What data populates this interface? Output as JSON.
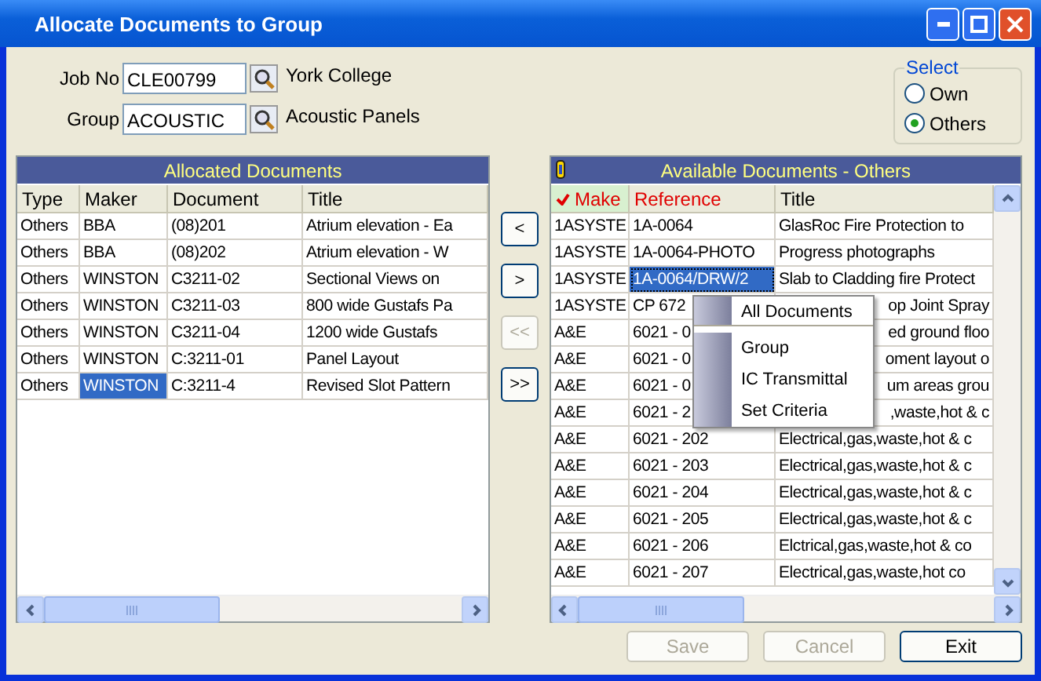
{
  "window": {
    "title": "Allocate Documents to Group"
  },
  "fields": [
    {
      "label": "Job No",
      "value": "CLE00799",
      "description": "York College"
    },
    {
      "label": "Group",
      "value": "ACOUSTIC",
      "description": "Acoustic Panels"
    }
  ],
  "select": {
    "title": "Select",
    "options": [
      {
        "label": "Own",
        "selected": false
      },
      {
        "label": "Others",
        "selected": true
      }
    ]
  },
  "allocated": {
    "title": "Allocated Documents",
    "columns": [
      "Type",
      "Maker",
      "Document",
      "Title"
    ],
    "rows": [
      {
        "cells": [
          {
            "text": "Others",
            "selected": false
          },
          {
            "text": "BBA",
            "selected": false
          },
          {
            "text": "(08)201",
            "selected": false
          },
          {
            "text": "Atrium elevation - Ea",
            "selected": false
          }
        ]
      },
      {
        "cells": [
          {
            "text": "Others",
            "selected": false
          },
          {
            "text": "BBA",
            "selected": false
          },
          {
            "text": "(08)202",
            "selected": false
          },
          {
            "text": "Atrium elevation - W",
            "selected": false
          }
        ]
      },
      {
        "cells": [
          {
            "text": "Others",
            "selected": false
          },
          {
            "text": "WINSTON",
            "selected": false
          },
          {
            "text": "C3211-02",
            "selected": false
          },
          {
            "text": "Sectional Views on",
            "selected": false
          }
        ]
      },
      {
        "cells": [
          {
            "text": "Others",
            "selected": false
          },
          {
            "text": "WINSTON",
            "selected": false
          },
          {
            "text": "C3211-03",
            "selected": false
          },
          {
            "text": "800 wide Gustafs Pa",
            "selected": false
          }
        ]
      },
      {
        "cells": [
          {
            "text": "Others",
            "selected": false
          },
          {
            "text": "WINSTON",
            "selected": false
          },
          {
            "text": "C3211-04",
            "selected": false
          },
          {
            "text": "1200 wide Gustafs",
            "selected": false
          }
        ]
      },
      {
        "cells": [
          {
            "text": "Others",
            "selected": false
          },
          {
            "text": "WINSTON",
            "selected": false
          },
          {
            "text": "C:3211-01",
            "selected": false
          },
          {
            "text": "Panel Layout",
            "selected": false
          }
        ]
      },
      {
        "cells": [
          {
            "text": "Others",
            "selected": false
          },
          {
            "text": "WINSTON",
            "selected": true
          },
          {
            "text": "C:3211-4",
            "selected": false
          },
          {
            "text": "Revised Slot Pattern",
            "selected": false
          }
        ]
      }
    ]
  },
  "move_buttons": [
    {
      "label": "<",
      "disabled": false
    },
    {
      "label": ">",
      "disabled": false
    },
    {
      "label": "<<",
      "disabled": true
    },
    {
      "label": ">>",
      "disabled": false
    }
  ],
  "available": {
    "title": "Available Documents - Others",
    "columns": [
      {
        "label": "Make",
        "checked": true,
        "highlighted": true
      },
      {
        "label": "Reference",
        "checked": false,
        "highlighted": true
      },
      {
        "label": "Title",
        "checked": false,
        "highlighted": false
      }
    ],
    "rows": [
      {
        "kind": "plain",
        "cells": [
          {
            "text": "1ASYSTE",
            "selected": false
          },
          {
            "text": "1A-0064",
            "selected": false
          },
          {
            "text": "GlasRoc Fire Protection to",
            "selected": false
          }
        ]
      },
      {
        "kind": "plain",
        "cells": [
          {
            "text": "1ASYSTE",
            "selected": false
          },
          {
            "text": "1A-0064-PHOTO",
            "selected": false
          },
          {
            "text": "Progress photographs",
            "selected": false
          }
        ]
      },
      {
        "kind": "plain",
        "cells": [
          {
            "text": "1ASYSTE",
            "selected": false
          },
          {
            "text": "1A-0064/DRW/2",
            "selected": true
          },
          {
            "text": "Slab to Cladding fire Protect",
            "selected": false
          }
        ]
      },
      {
        "kind": "covered",
        "cells": [
          {
            "text": "1ASYSTE",
            "selected": false
          },
          {
            "text": "CP 672",
            "selected": false
          },
          {
            "text": "op Joint Spray",
            "selected": false
          }
        ]
      },
      {
        "kind": "covered",
        "cells": [
          {
            "text": "A&E",
            "selected": false
          },
          {
            "text": "6021 - 0",
            "selected": false
          },
          {
            "text": "ed ground floo",
            "selected": false
          }
        ]
      },
      {
        "kind": "covered",
        "cells": [
          {
            "text": "A&E",
            "selected": false
          },
          {
            "text": "6021 - 0",
            "selected": false
          },
          {
            "text": "oment layout o",
            "selected": false
          }
        ]
      },
      {
        "kind": "covered",
        "cells": [
          {
            "text": "A&E",
            "selected": false
          },
          {
            "text": "6021 - 0",
            "selected": false
          },
          {
            "text": "um areas grou",
            "selected": false
          }
        ]
      },
      {
        "kind": "covered",
        "cells": [
          {
            "text": "A&E",
            "selected": false
          },
          {
            "text": "6021 - 2",
            "selected": false
          },
          {
            "text": ",waste,hot & c",
            "selected": false
          }
        ]
      },
      {
        "kind": "plain",
        "cells": [
          {
            "text": "A&E",
            "selected": false
          },
          {
            "text": "6021 - 202",
            "selected": false
          },
          {
            "text": "Electrical,gas,waste,hot & c",
            "selected": false
          }
        ]
      },
      {
        "kind": "plain",
        "cells": [
          {
            "text": "A&E",
            "selected": false
          },
          {
            "text": "6021 - 203",
            "selected": false
          },
          {
            "text": "Electrical,gas,waste,hot & c",
            "selected": false
          }
        ]
      },
      {
        "kind": "plain",
        "cells": [
          {
            "text": "A&E",
            "selected": false
          },
          {
            "text": "6021 - 204",
            "selected": false
          },
          {
            "text": "Electrical,gas,waste,hot & c",
            "selected": false
          }
        ]
      },
      {
        "kind": "plain",
        "cells": [
          {
            "text": "A&E",
            "selected": false
          },
          {
            "text": "6021 - 205",
            "selected": false
          },
          {
            "text": "Electrical,gas,waste,hot & c",
            "selected": false
          }
        ]
      },
      {
        "kind": "plain",
        "cells": [
          {
            "text": "A&E",
            "selected": false
          },
          {
            "text": "6021 - 206",
            "selected": false
          },
          {
            "text": "Elctrical,gas,waste,hot & co",
            "selected": false
          }
        ]
      },
      {
        "kind": "plain",
        "cells": [
          {
            "text": "A&E",
            "selected": false
          },
          {
            "text": "6021 - 207",
            "selected": false
          },
          {
            "text": "Electrical,gas,waste,hot  co",
            "selected": false
          }
        ]
      }
    ]
  },
  "context_menu": {
    "items": [
      {
        "label": "All Documents",
        "separator_after": true
      },
      {
        "label": "Group",
        "separator_after": false
      },
      {
        "label": "IC Transmittal",
        "separator_after": false
      },
      {
        "label": "Set Criteria",
        "separator_after": false
      }
    ]
  },
  "buttons": [
    {
      "label": "Save",
      "disabled": true
    },
    {
      "label": "Cancel",
      "disabled": true
    },
    {
      "label": "Exit",
      "disabled": false
    }
  ]
}
